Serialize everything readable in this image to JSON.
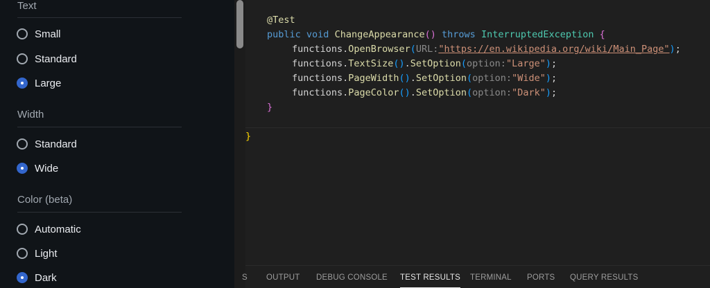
{
  "appearance_panel": {
    "sections": [
      {
        "heading": "Text",
        "options": [
          "Small",
          "Standard",
          "Large"
        ],
        "selected": "Large"
      },
      {
        "heading": "Width",
        "options": [
          "Standard",
          "Wide"
        ],
        "selected": "Wide"
      },
      {
        "heading": "Color (beta)",
        "options": [
          "Automatic",
          "Light",
          "Dark"
        ],
        "selected": "Dark"
      }
    ]
  },
  "editor": {
    "lines": {
      "annotation": "@Test",
      "method_sig": {
        "kw1": "public",
        "kw2": "void",
        "name": "ChangeAppearance",
        "parens": "()",
        "throws": "throws",
        "exception": "InterruptedException",
        "brace": "{"
      },
      "open_browser": {
        "obj": "functions",
        "method": "OpenBrowser",
        "hint": "URL:",
        "url": "\"https://en.wikipedia.org/wiki/Main_Page\""
      },
      "text_size": {
        "obj": "functions",
        "method": "TextSize",
        "call": "SetOption",
        "hint": "option:",
        "value": "\"Large\""
      },
      "page_width": {
        "obj": "functions",
        "method": "PageWidth",
        "call": "SetOption",
        "hint": "option:",
        "value": "\"Wide\""
      },
      "page_color": {
        "obj": "functions",
        "method": "PageColor",
        "call": "SetOption",
        "hint": "option:",
        "value": "\"Dark\""
      },
      "method_close": "}",
      "class_close": "}"
    }
  },
  "panel_tabs": [
    {
      "label": "S",
      "active": false
    },
    {
      "label": "OUTPUT",
      "active": false
    },
    {
      "label": "DEBUG CONSOLE",
      "active": false
    },
    {
      "label": "TEST RESULTS",
      "active": true
    },
    {
      "label": "TERMINAL",
      "active": false
    },
    {
      "label": "PORTS",
      "active": false
    },
    {
      "label": "QUERY RESULTS",
      "active": false
    }
  ],
  "colors": {
    "accent_radio": "#3366cc",
    "panel_background": "#101418",
    "editor_background": "#1f1f1f"
  }
}
